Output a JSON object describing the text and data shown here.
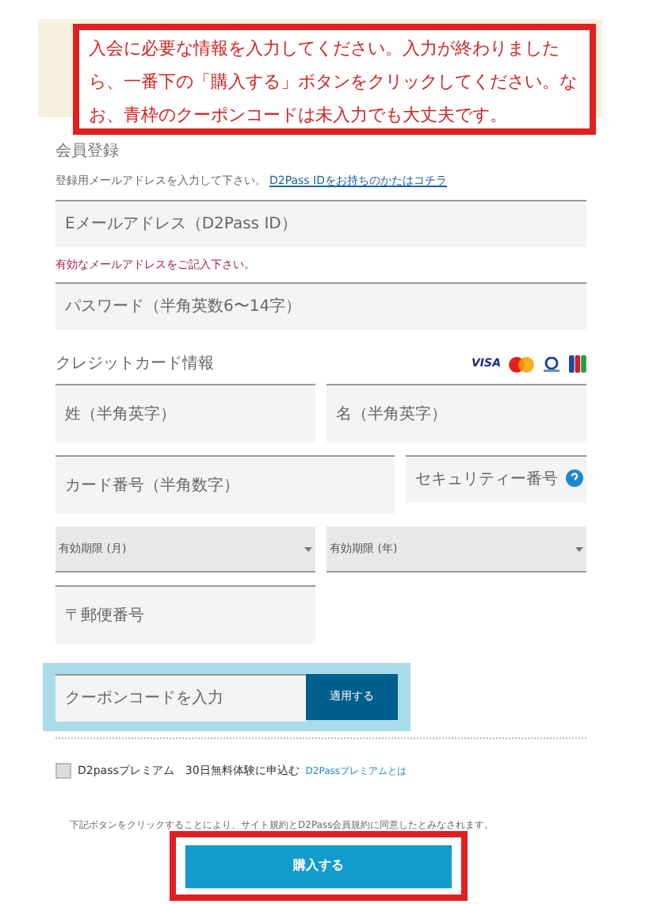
{
  "notice": "入会に必要な情報を入力してください。入力が終わりましたら、一番下の「購入する」ボタンをクリックしてください。なお、青枠のクーポンコードは未入力でも大丈夫です。",
  "section_title": "会員登録",
  "email_hint": {
    "text": "登録用メールアドレスを入力して下さい。",
    "link": "D2Pass IDをお持ちのかたはコチラ"
  },
  "account_fields": [
    {
      "kind": "input",
      "placeholder": "Eメールアドレス（D2Pass ID）"
    },
    {
      "kind": "error",
      "text": "有効なメールアドレスをご記入下さい。"
    },
    {
      "kind": "input",
      "placeholder": "パスワード（半角英数6〜14字）"
    }
  ],
  "card_section": {
    "title": "クレジットカード情報",
    "brand_label": "VISA"
  },
  "card_rows": [
    [
      {
        "kind": "input",
        "placeholder": "姓（半角英字）"
      },
      {
        "kind": "input",
        "placeholder": "名（半角英字）"
      }
    ],
    [
      {
        "kind": "wide_input",
        "placeholder": "カード番号（半角数字）"
      },
      {
        "kind": "info",
        "placeholder": "セキュリティー番号"
      }
    ],
    [
      {
        "kind": "select",
        "placeholder": "有効期限 (月)"
      },
      {
        "kind": "select",
        "placeholder": "有効期限 (年)"
      }
    ],
    [
      {
        "kind": "input",
        "placeholder": "〒郵便番号"
      }
    ]
  ],
  "coupon": {
    "placeholder": "クーポンコードを入力",
    "button": "適用する"
  },
  "premium": {
    "checked": false,
    "label": "D2passプレミアム　30日無料体験に申込む",
    "link": "D2Passプレミアムとは"
  },
  "agreement": "下記ボタンをクリックすることにより、サイト規約とD2Pass会員規約に同意したとみなされます。",
  "buy_button": "購入する"
}
